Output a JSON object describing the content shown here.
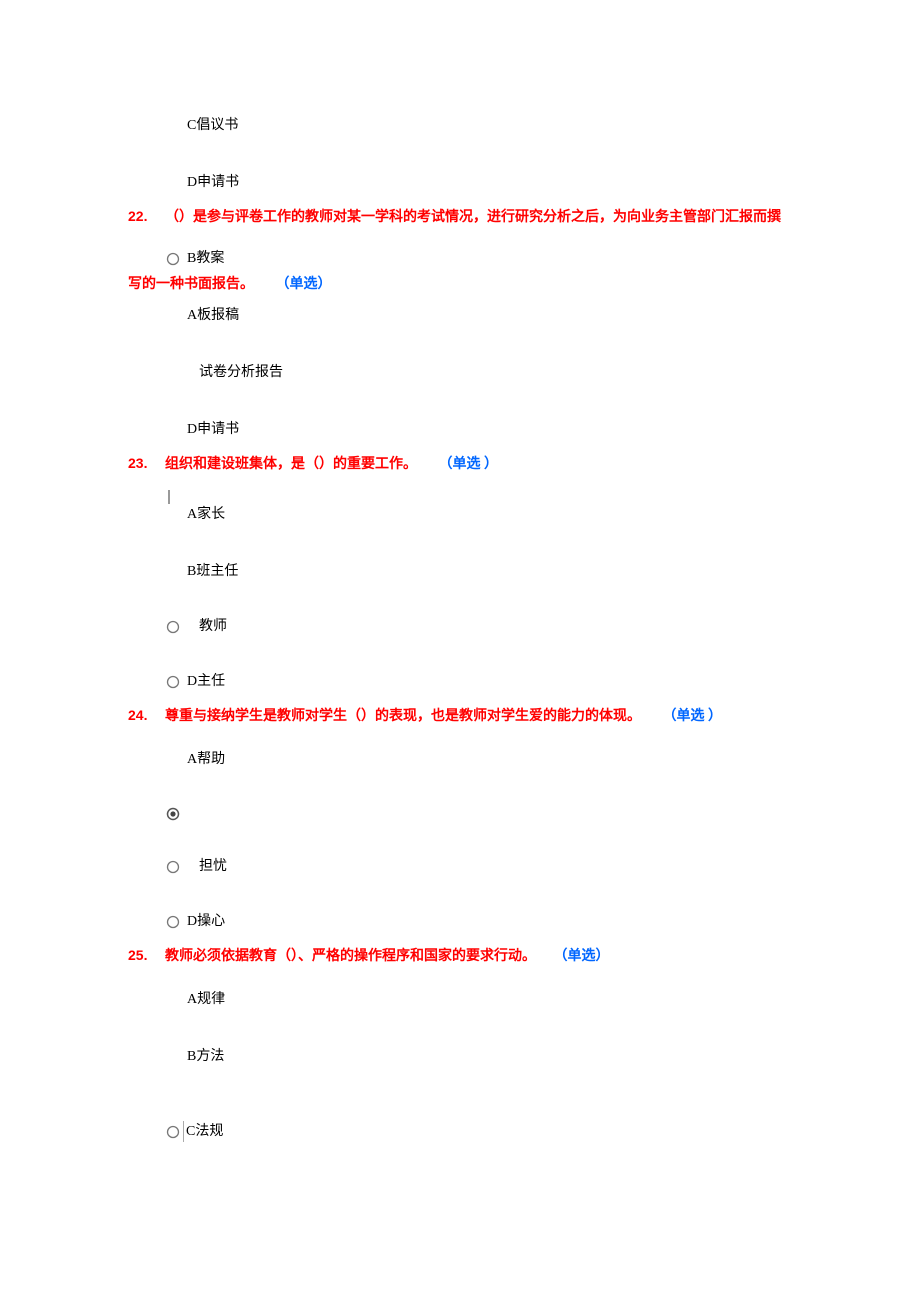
{
  "q21_tail": {
    "optC": "C倡议书",
    "optD": "D申请书"
  },
  "q22": {
    "num": "22.",
    "text_part1": "（）是参与评卷工作的教师对某一学科的考试情况，进行研究分析之后，为向业务主管部门汇报而撰",
    "optB_inline": "B教案",
    "text_part2": "写的一种书面报告。",
    "tag": "（单选）",
    "optA": "A板报稿",
    "optC": "试卷分析报告",
    "optD": "D申请书"
  },
  "q23": {
    "num": "23.",
    "text": "组织和建设班集体，是（）的重要工作。",
    "tag": "（单选 ）",
    "optA": "A家长",
    "optB": "B班主任",
    "optC": "教师",
    "optD": "D主任"
  },
  "q24": {
    "num": "24.",
    "text": "尊重与接纳学生是教师对学生（）的表现，也是教师对学生爱的能力的体现。",
    "tag": "（单选 ）",
    "optA": "A帮助",
    "optC": "担忧",
    "optD": "D操心"
  },
  "q25": {
    "num": "25.",
    "text": "教师必须依据教育（）、严格的操作程序和国家的要求行动。",
    "tag": "（单选）",
    "optA": "A规律",
    "optB": "B方法",
    "optC": "C法规"
  }
}
